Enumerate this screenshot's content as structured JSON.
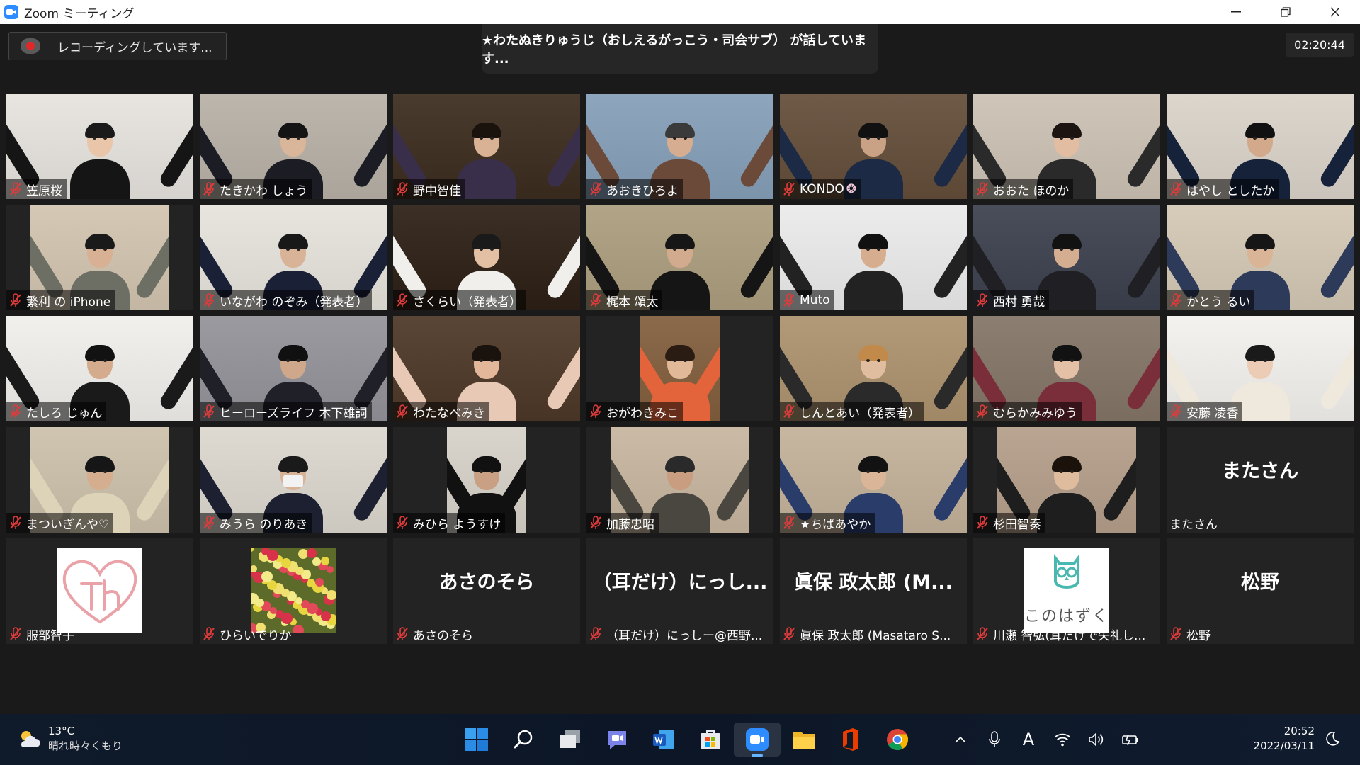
{
  "window": {
    "title": "Zoom ミーティング"
  },
  "recording": {
    "label": "レコーディングしています..."
  },
  "speaking": {
    "text": "★わたぬきりゅうじ（おしえるがっこう・司会サブ） が話しています..."
  },
  "timer": {
    "value": "02:20:44"
  },
  "participants": [
    {
      "name": "笠原桜",
      "bg": "#e8e5e0",
      "vid": "full",
      "skin": "#e9c5aa",
      "hair": "#1a1a1a",
      "cloth": "#151515"
    },
    {
      "name": "たきかわ しょう",
      "bg": "#bdb6ad",
      "vid": "full",
      "skin": "#d9b599",
      "hair": "#141414",
      "cloth": "#1c1c24"
    },
    {
      "name": "野中智佳",
      "bg": "#4a3b2f",
      "vid": "full",
      "skin": "#d9b195",
      "hair": "#1a120c",
      "cloth": "#3a2f4a"
    },
    {
      "name": "あおきひろよ",
      "bg": "#8ea6bd",
      "vid": "full",
      "skin": "#d6ad90",
      "hair": "#3a3a3a",
      "cloth": "#6b4a3a"
    },
    {
      "name": "KONDO",
      "emoji": "❂",
      "bg": "#6e5a47",
      "vid": "full",
      "skin": "#c9a185",
      "hair": "#111111",
      "cloth": "#1d2a45"
    },
    {
      "name": "おおた ほのか",
      "bg": "#cfc6b9",
      "vid": "full",
      "skin": "#e2bda1",
      "hair": "#1b1410",
      "cloth": "#2a2a2a"
    },
    {
      "name": "はやし としたか",
      "bg": "#ddd6cc",
      "vid": "full",
      "skin": "#d3a98c",
      "hair": "#111111",
      "cloth": "#16223a"
    },
    {
      "name": "繁利 の iPhone",
      "bg": "#d5c8b5",
      "vid": "center",
      "vw": 196,
      "skin": "#d8b093",
      "hair": "#1a1a1a",
      "cloth": "#6d6e64"
    },
    {
      "name": "いながわ のぞみ（発表者）",
      "bg": "#e8e4de",
      "vid": "full",
      "skin": "#d9b397",
      "hair": "#181818",
      "cloth": "#1a2136"
    },
    {
      "name": "さくらい（発表者）",
      "bg": "#3b2f26",
      "vid": "full",
      "skin": "#e3c0a4",
      "hair": "#1a1a1a",
      "cloth": "#f0efec"
    },
    {
      "name": "梶本 頌太",
      "bg": "#b2a487",
      "vid": "full",
      "skin": "#d2ab8e",
      "hair": "#161616",
      "cloth": "#151515"
    },
    {
      "name": "Muto",
      "bg": "#ececec",
      "vid": "full",
      "skin": "#d7ad90",
      "hair": "#111111",
      "cloth": "#222222"
    },
    {
      "name": "西村 勇哉",
      "bg": "#4a4e5a",
      "vid": "full",
      "skin": "#d5ad91",
      "hair": "#121212",
      "cloth": "#1f1f24"
    },
    {
      "name": "かとう るい",
      "bg": "#d7ccba",
      "vid": "full",
      "skin": "#dab497",
      "hair": "#161616",
      "cloth": "#2d3a5a"
    },
    {
      "name": "たしろ じゅん",
      "bg": "#f1f0ed",
      "vid": "full",
      "skin": "#d4ab8d",
      "hair": "#121212",
      "cloth": "#1a1a1a"
    },
    {
      "name": "ヒーローズライフ 木下雄詞",
      "bg": "#9a9aa0",
      "vid": "full",
      "skin": "#cfa88c",
      "hair": "#101010",
      "cloth": "#202028"
    },
    {
      "name": "わたなべみき",
      "bg": "#5a4636",
      "vid": "full",
      "skin": "#e2b79a",
      "hair": "#1a120c",
      "cloth": "#e8c9b5"
    },
    {
      "name": "おがわきみこ",
      "bg": "#8a6a4a",
      "vid": "center",
      "vw": 112,
      "skin": "#e1b999",
      "hair": "#2a1c12",
      "cloth": "#e3643a"
    },
    {
      "name": "しんとあい（発表者）",
      "bg": "#b29a78",
      "vid": "full",
      "skin": "#e0bd9f",
      "hair": "#c28a4a",
      "cloth": "#2a2a2a"
    },
    {
      "name": "むらかみみゆう",
      "bg": "#8c7f72",
      "vid": "full",
      "skin": "#e3c0a6",
      "hair": "#121212",
      "cloth": "#7a2e3a"
    },
    {
      "name": "安藤 凌香",
      "bg": "#f4f2ee",
      "vid": "full",
      "skin": "#ecccb4",
      "hair": "#1a1a1a",
      "cloth": "#efe8dc"
    },
    {
      "name": "まついぎんや♡",
      "bg": "#cfc5b1",
      "vid": "center",
      "vw": 196,
      "skin": "#d5ad8f",
      "hair": "#161616",
      "cloth": "#dcd3b8"
    },
    {
      "name": "みうら のりあき",
      "bg": "#dedad2",
      "vid": "full",
      "skin": "#d8b295",
      "hair": "#1a1a1a",
      "cloth": "#1c2030",
      "mask": true
    },
    {
      "name": "みひら ようすけ",
      "bg": "#d9d4cc",
      "vid": "center",
      "vw": 112,
      "skin": "#c9a083",
      "hair": "#111111",
      "cloth": "#111111"
    },
    {
      "name": "加藤忠昭",
      "bg": "#cbbba6",
      "vid": "center",
      "vw": 196,
      "skin": "#c99e80",
      "hair": "#2a2a2a",
      "cloth": "#4a4640"
    },
    {
      "name": "★ちばあやか",
      "bg": "#c7b7a1",
      "vid": "full",
      "skin": "#dbb597",
      "hair": "#121212",
      "cloth": "#2a3d6a"
    },
    {
      "name": "杉田智奏",
      "bg": "#b9a592",
      "vid": "center",
      "vw": 196,
      "skin": "#e0bc9f",
      "hair": "#1b120c",
      "cloth": "#1e1e1e"
    },
    {
      "name": "またさん",
      "type": "name",
      "big": "またさん",
      "nomic": true
    },
    {
      "name": "服部智子",
      "type": "img-th"
    },
    {
      "name": "ひらいでりか",
      "type": "img-flowers"
    },
    {
      "name": "あさのそら",
      "type": "name",
      "big": "あさのそら"
    },
    {
      "name": "（耳だけ）にっしー@西野...",
      "type": "name",
      "big": "（耳だけ）にっし..."
    },
    {
      "name": "眞保 政太郎 (Masataro S...",
      "type": "name",
      "big": "眞保 政太郎 (M..."
    },
    {
      "name": "川瀬 智弘(耳だけで失礼し...",
      "type": "img-owl",
      "owltext": "このはずく"
    },
    {
      "name": "松野",
      "type": "name",
      "big": "松野"
    }
  ],
  "taskbar": {
    "weather": {
      "temp": "13°C",
      "desc": "晴れ時々くもり"
    },
    "clock": {
      "time": "20:52",
      "date": "2022/03/11"
    },
    "ime": "A"
  },
  "colors": {
    "accent": "#2d8cff",
    "mic_muted": "#e03b3b",
    "record": "#e02828"
  }
}
